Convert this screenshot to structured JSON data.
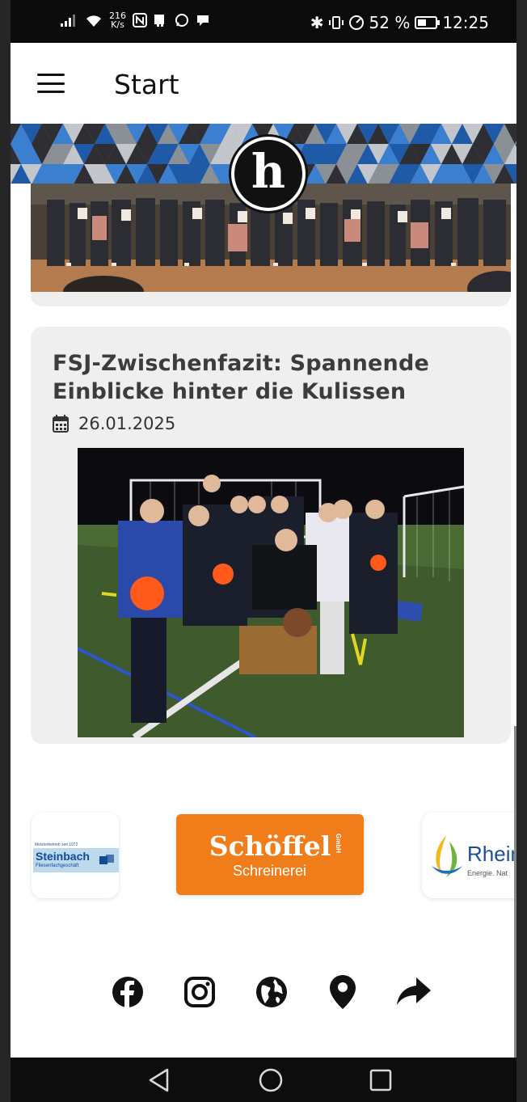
{
  "status_bar": {
    "net_speed_value": "216",
    "net_speed_unit": "K/s",
    "battery": "52 %",
    "battery_level": 0.52,
    "time": "12:25"
  },
  "app_bar": {
    "title": "Start",
    "menu_icon": "hamburger-menu-icon"
  },
  "header": {
    "logo_letter": "h",
    "accent_colors": [
      "#3b7fd0",
      "#1e5aa8",
      "#2f2f33",
      "#8b9097",
      "#c3c7cc"
    ]
  },
  "news": [
    {
      "title": "FSJ-Zwischenfazit: Spannende Einblicke hinter die Kulissen",
      "date": "26.01.2025",
      "date_icon": "calendar-icon"
    }
  ],
  "sponsors": [
    {
      "top_line": "Meisterbetrieb seit 1972",
      "name": "Steinbach",
      "sub": "Fliesenfachgeschäft"
    },
    {
      "name": "Schöffel",
      "suffix": "GmbH",
      "sub": "Schreinerei",
      "color": "#f07d1a"
    },
    {
      "name": "Rhein",
      "sub": "Energie. Nat"
    }
  ],
  "social_links": [
    "facebook-icon",
    "instagram-icon",
    "globe-icon",
    "location-pin-icon",
    "share-icon"
  ],
  "nav_bar": [
    "back-icon",
    "home-icon",
    "recents-icon"
  ]
}
